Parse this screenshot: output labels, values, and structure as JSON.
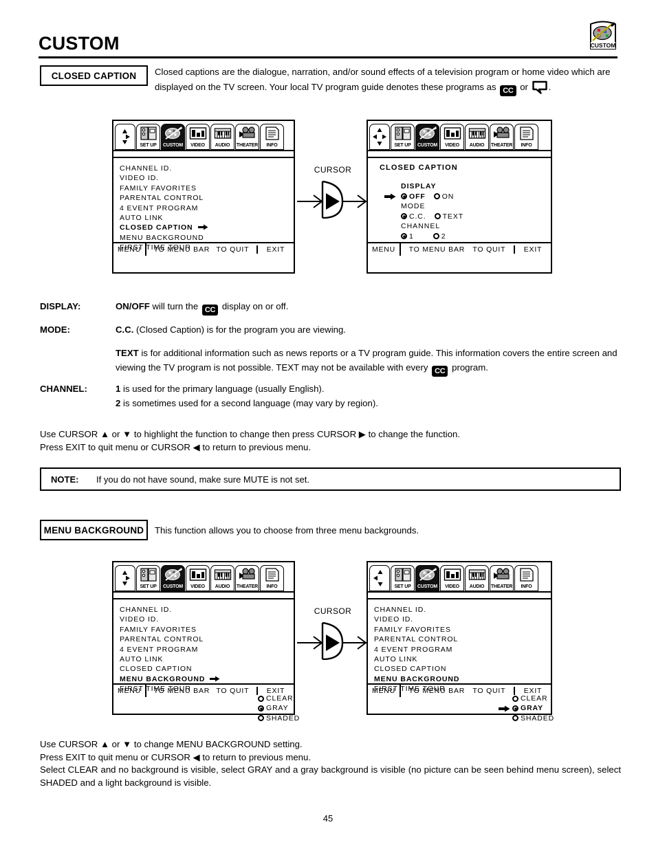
{
  "header": {
    "title": "CUSTOM",
    "badge_label": "CUSTOM",
    "badge_icon": "palette-custom-icon"
  },
  "closed_caption_section": {
    "label": "CLOSED CAPTION",
    "intro_part1": "Closed captions are the dialogue, narration, and/or sound effects of a television program or home video which are displayed on the TV screen.  Your local TV program guide denotes these programs as",
    "cc_glyph": "CC",
    "intro_or": "or",
    "intro_end": "."
  },
  "menu_background_section": {
    "label": "MENU BACKGROUND",
    "intro": "This function allows you to choose from three menu backgrounds."
  },
  "menu_bar": {
    "tabs": [
      {
        "label": "SET UP",
        "icon": "setup-icon",
        "active": false
      },
      {
        "label": "CUSTOM",
        "icon": "palette-icon",
        "active": true
      },
      {
        "label": "VIDEO",
        "icon": "tv-icon",
        "active": false
      },
      {
        "label": "AUDIO",
        "icon": "keyboard-icon",
        "active": false
      },
      {
        "label": "THEATER",
        "icon": "projector-icon",
        "active": false
      },
      {
        "label": "INFO",
        "icon": "document-icon",
        "active": false
      }
    ]
  },
  "custom_menu_items": [
    "CHANNEL ID.",
    "VIDEO ID.",
    "FAMILY FAVORITES",
    "PARENTAL CONTROL",
    "4 EVENT PROGRAM",
    "AUTO LINK",
    "CLOSED CAPTION",
    "MENU BACKGROUND",
    "FIRST TIME TOUR"
  ],
  "osd_footer": {
    "menu": "MENU",
    "to_menu_bar": "TO MENU BAR",
    "to_quit": "TO QUIT",
    "exit": "EXIT"
  },
  "osd1": {
    "dpad": "dpad-up-right-down-icon",
    "selected_item": "CLOSED CAPTION",
    "cursor_arrow": "right-arrow-icon"
  },
  "osd2": {
    "dpad": "dpad-four-way-icon",
    "heading": "CLOSED CAPTION",
    "groups": [
      {
        "label": "DISPLAY",
        "cursor": true,
        "options": [
          {
            "label": "OFF",
            "selected": true
          },
          {
            "label": "ON",
            "selected": false
          }
        ]
      },
      {
        "label": "MODE",
        "cursor": false,
        "options": [
          {
            "label": "C.C.",
            "selected": true
          },
          {
            "label": "TEXT",
            "selected": false
          }
        ]
      },
      {
        "label": "CHANNEL",
        "cursor": false,
        "options": [
          {
            "label": "1",
            "selected": true
          },
          {
            "label": "2",
            "selected": false
          }
        ]
      }
    ]
  },
  "osd3": {
    "dpad": "dpad-up-right-down-icon",
    "selected_item": "MENU BACKGROUND",
    "cursor_arrow": "right-arrow-icon",
    "background_options": [
      {
        "label": "CLEAR",
        "selected": false,
        "cursor": false
      },
      {
        "label": "GRAY",
        "selected": true,
        "cursor": false
      },
      {
        "label": "SHADED",
        "selected": false,
        "cursor": false
      }
    ]
  },
  "osd4": {
    "dpad": "dpad-left-up-down-icon",
    "selected_item": "MENU BACKGROUND",
    "background_options": [
      {
        "label": "CLEAR",
        "selected": false,
        "cursor": false
      },
      {
        "label": "GRAY",
        "selected": true,
        "cursor": true
      },
      {
        "label": "SHADED",
        "selected": false,
        "cursor": false
      }
    ]
  },
  "cursor_graphic": {
    "label": "CURSOR",
    "icon": "cursor-right-button-icon"
  },
  "descriptions": {
    "display_key": "DISPLAY:",
    "display_term": "ON/OFF",
    "display_text_a": "will turn the",
    "display_text_b": "display on or off.",
    "mode_key": "MODE:",
    "mode_term1": "C.C.",
    "mode_text1": "(Closed Caption) is for the program you are viewing.",
    "mode_term2": "TEXT",
    "mode_text2a": "is for additional information such as news reports or a TV program guide.  This information covers the entire screen and viewing the TV program is not possible.  TEXT may not be available with every",
    "mode_text2b": "program.",
    "channel_key": "CHANNEL:",
    "channel_term1": "1",
    "channel_text1": "is used for the primary language (usually English).",
    "channel_term2": "2",
    "channel_text2": "is sometimes used for a second language (may vary by region)."
  },
  "instructions_1": {
    "line1_a": "Use CURSOR",
    "line1_b": "or",
    "line1_c": "to highlight the function to change then press CURSOR",
    "line1_d": "to change the function.",
    "line2_a": "Press EXIT to quit menu or CURSOR",
    "line2_b": "to return to previous menu."
  },
  "note": {
    "key": "NOTE:",
    "text": "If you do not have sound, make sure MUTE is not set."
  },
  "instructions_2": {
    "line1_a": "Use CURSOR",
    "line1_b": "or",
    "line1_c": "to change MENU BACKGROUND setting.",
    "line2_a": "Press EXIT to quit menu or CURSOR",
    "line2_b": "to return to previous menu.",
    "line3": "Select CLEAR and no background is visible, select GRAY and a gray background is visible (no picture can be seen behind menu screen), select SHADED and a light background is visible."
  },
  "page_number": "45"
}
